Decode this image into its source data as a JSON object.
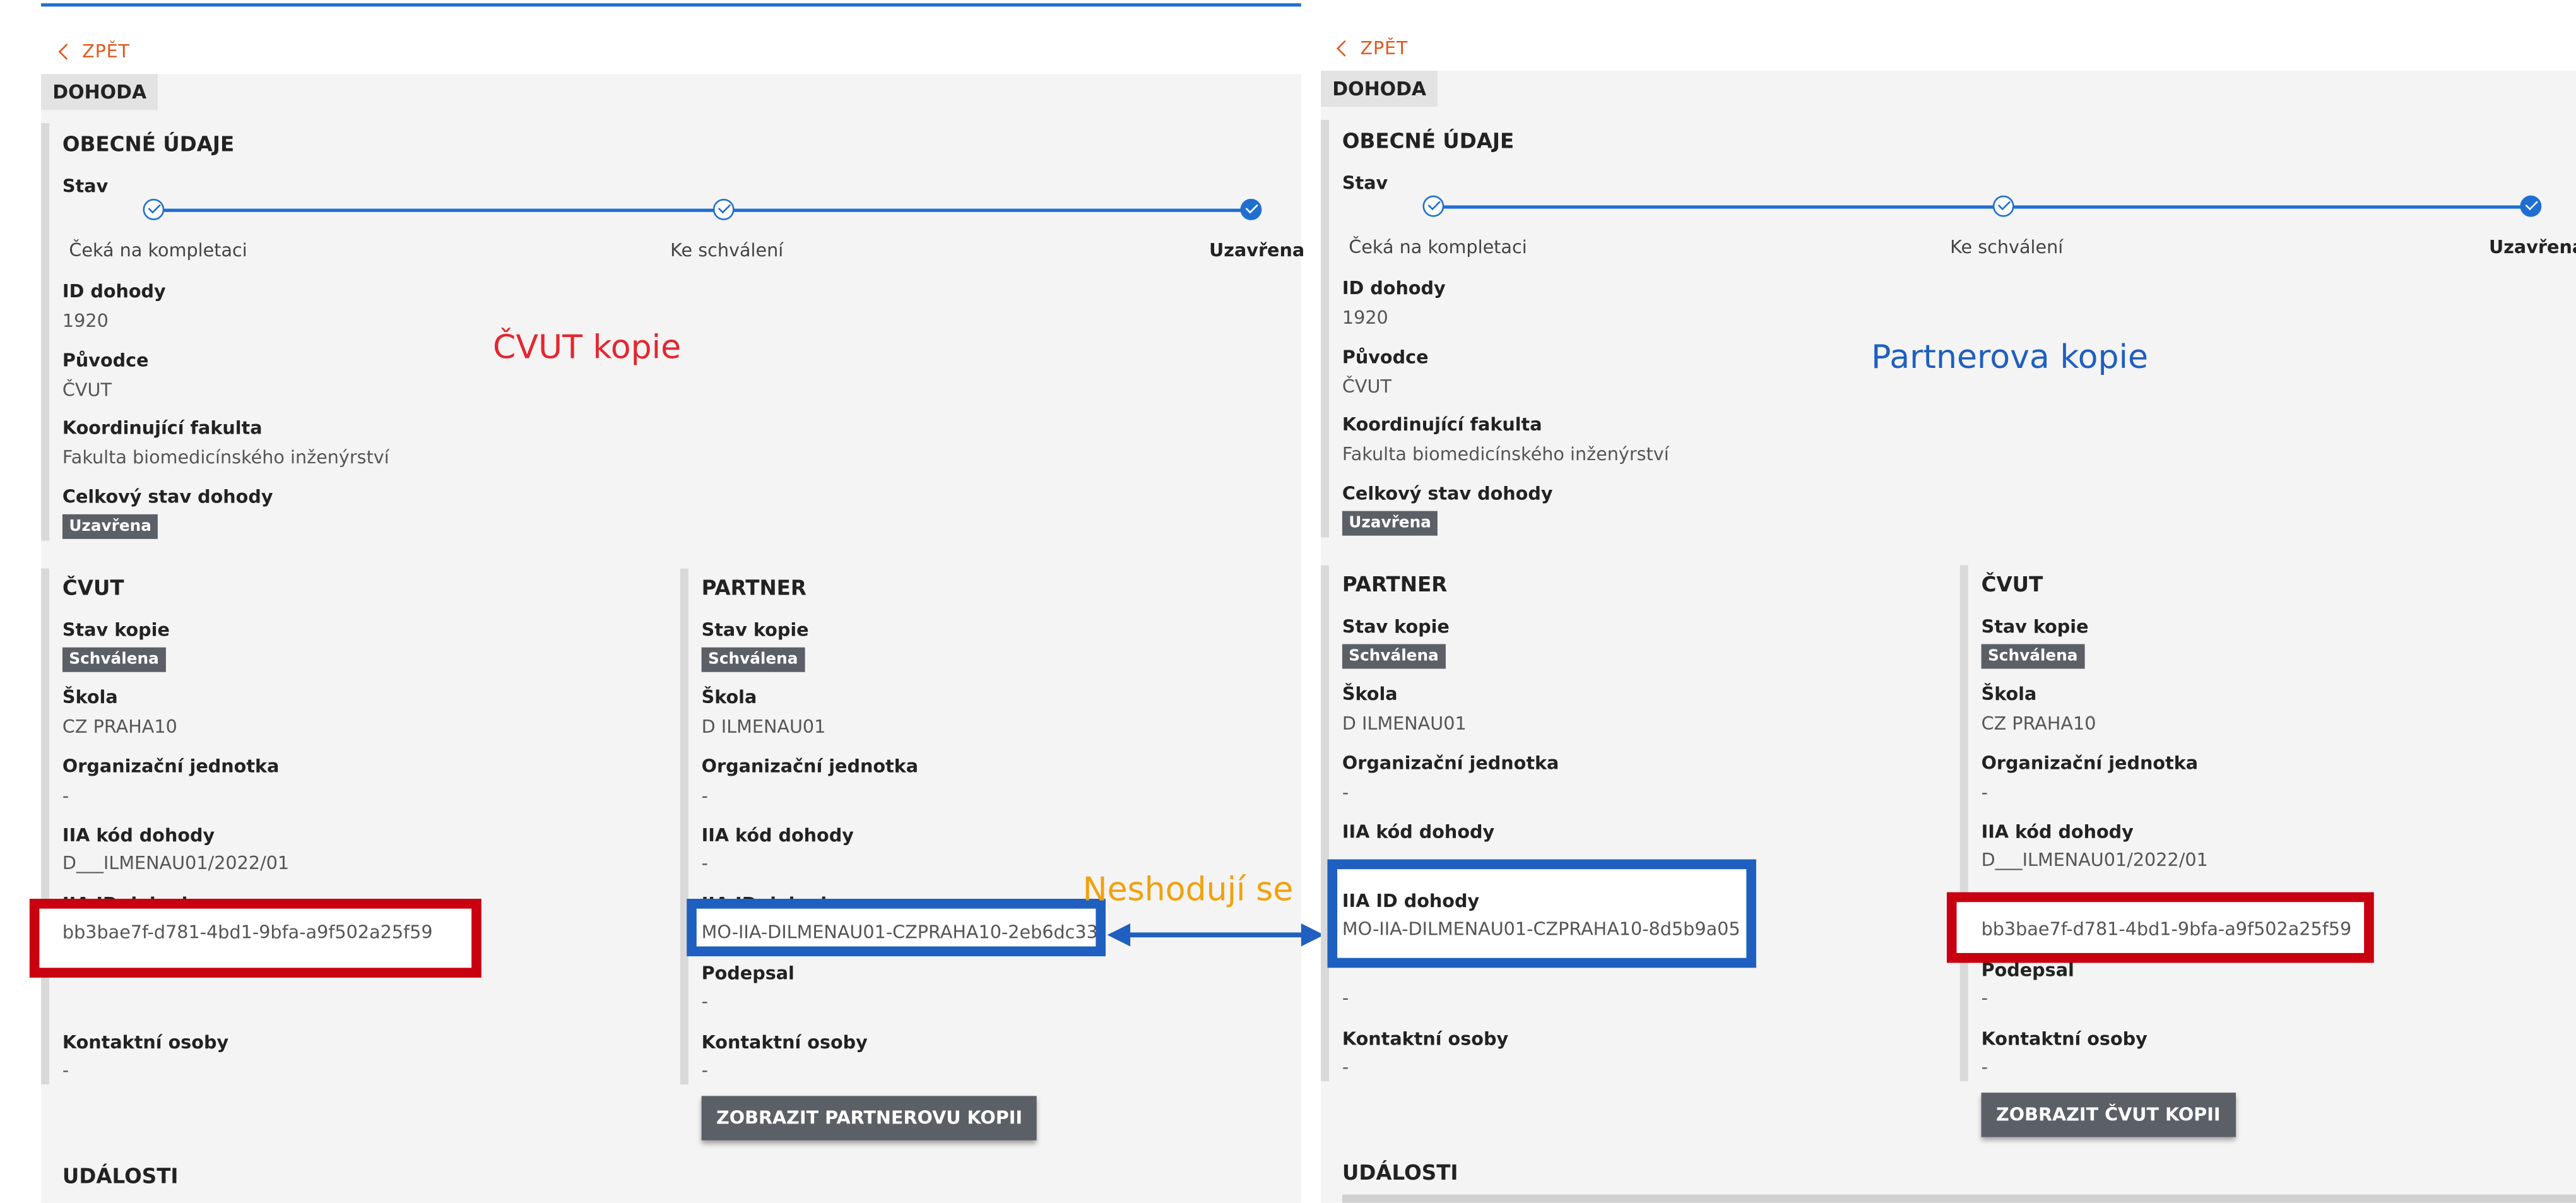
{
  "nav": {
    "back_label": "ZPĚT"
  },
  "tab_label": "DOHODA",
  "general": {
    "title": "OBECNÉ ÚDAJE",
    "status_label": "Stav",
    "steps": [
      "Čeká na kompletaci",
      "Ke schválení",
      "Uzavřena"
    ],
    "id_label": "ID dohody",
    "id_value": "1920",
    "origin_label": "Původce",
    "origin_value": "ČVUT",
    "faculty_label": "Koordinující fakulta",
    "faculty_value": "Fakulta biomedicínského inženýrství",
    "overall_label": "Celkový stav dohody",
    "overall_badge": "Uzavřena"
  },
  "field_labels": {
    "copy_status": "Stav kopie",
    "school": "Škola",
    "org_unit": "Organizační jednotka",
    "iia_code": "IIA kód dohody",
    "iia_id": "IIA ID dohody",
    "signed": "Podepsal",
    "contacts": "Kontaktní osoby"
  },
  "party_cvut": {
    "title": "ČVUT",
    "copy_status": "Schválena",
    "school": "CZ PRAHA10",
    "org_unit": "-",
    "iia_code": "D___ILMENAU01/2022/01",
    "iia_id": "bb3bae7f-d781-4bd1-9bfa-a9f502a25f59",
    "signed": "-",
    "contacts": "-"
  },
  "party_partner_left": {
    "title": "PARTNER",
    "copy_status": "Schválena",
    "school": "D ILMENAU01",
    "org_unit": "-",
    "iia_code": "-",
    "iia_id": "MO-IIA-DILMENAU01-CZPRAHA10-2eb6dc33",
    "signed": "-",
    "contacts": "-"
  },
  "party_partner_right": {
    "title": "PARTNER",
    "copy_status": "Schválena",
    "school": "D ILMENAU01",
    "org_unit": "-",
    "iia_code": "",
    "iia_id": "MO-IIA-DILMENAU01-CZPRAHA10-8d5b9a05",
    "signed": "-",
    "contacts": "-"
  },
  "buttons": {
    "show_partner_copy": "ZOBRAZIT PARTNEROVU KOPII",
    "show_cvut_copy": "ZOBRAZIT ČVUT KOPII"
  },
  "events_title": "UDÁLOSTI",
  "annotations": {
    "left_caption": "ČVUT kopie",
    "right_caption": "Partnerova kopie",
    "mismatch": "Neshodují se"
  },
  "colors": {
    "accent": "#1f6fd1",
    "back_link": "#e0581e",
    "badge": "#5b5f66",
    "annotation_red": "#e4262f",
    "annotation_blue": "#1f5fbf",
    "annotation_orange": "#f2a10c",
    "highlight_red": "#c8000f"
  }
}
